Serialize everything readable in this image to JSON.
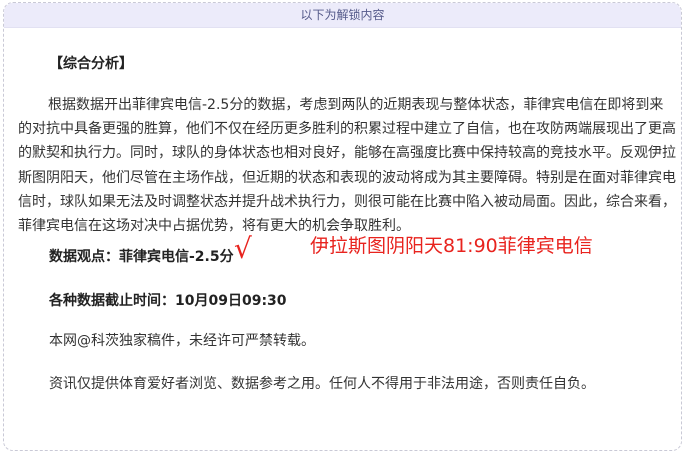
{
  "unlock_bar": {
    "label": "以下为解锁内容"
  },
  "article": {
    "section_title": "【综合分析】",
    "body": "根据数据开出菲律宾电信-2.5分的数据，考虑到两队的近期表现与整体状态，菲律宾电信在即将到来的对抗中具备更强的胜算，他们不仅在经历更多胜利的积累过程中建立了自信，也在攻防两端展现出了更高的默契和执行力。同时，球队的身体状态也相对良好，能够在高强度比赛中保持较高的竞技水平。反观伊拉斯图阴阳天，他们尽管在主场作战，但近期的状态和表现的波动将成为其主要障碍。特别是在面对菲律宾电信时，球队如果无法及时调整状态并提升战术执行力，则很可能在比赛中陷入被动局面。因此，综合来看，菲律宾电信在这场对决中占据优势，将有更大的机会争取胜利。",
    "viewpoint": "数据观点：菲律宾电信-2.5分",
    "check_mark": "√",
    "score_note": "伊拉斯图阴阳天81:90菲律宾电信",
    "deadline": "各种数据截止时间：10月09日09:30",
    "copyright": "本网@科茨独家稿件，未经许可严禁转载。",
    "disclaimer": "资讯仅提供体育爱好者浏览、数据参考之用。任何人不得用于非法用途，否则责任自负。"
  },
  "colors": {
    "accent_red": "#e8231e",
    "unlock_bar_bg": "#ecebfa"
  }
}
